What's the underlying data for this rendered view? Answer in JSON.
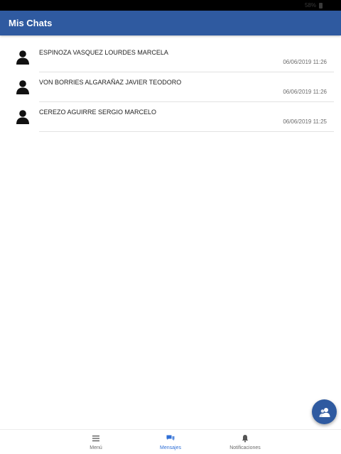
{
  "status_bar": {
    "right_text": "58%"
  },
  "header": {
    "title": "Mis Chats"
  },
  "chats": [
    {
      "name": "ESPINOZA VASQUEZ LOURDES MARCELA",
      "timestamp": "06/06/2019 11:26"
    },
    {
      "name": "VON BORRIES ALGARAÑAZ JAVIER TEODORO",
      "timestamp": "06/06/2019 11:26"
    },
    {
      "name": "CEREZO AGUIRRE SERGIO MARCELO",
      "timestamp": "06/06/2019 11:25"
    }
  ],
  "fab": {
    "icon": "new-group-chat-icon"
  },
  "bottom_nav": {
    "items": [
      {
        "label": "Menú",
        "icon": "menu-icon",
        "active": false
      },
      {
        "label": "Mensajes",
        "icon": "chat-bubbles-icon",
        "active": true
      },
      {
        "label": "Notificaciones",
        "icon": "bell-icon",
        "active": false
      }
    ]
  },
  "colors": {
    "primary": "#2f5aa0",
    "active_nav": "#2f6fd6",
    "text": "#222222",
    "muted_text": "#6b6b6b",
    "divider": "#e2e2e2"
  }
}
